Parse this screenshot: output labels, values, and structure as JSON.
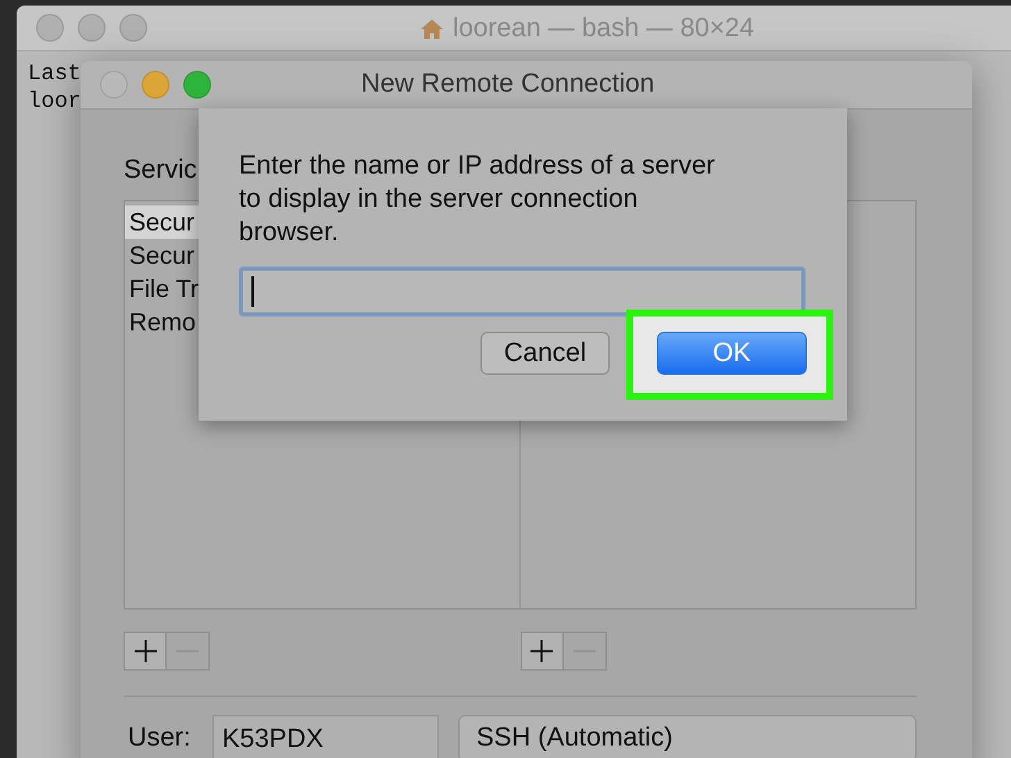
{
  "terminal": {
    "title": "loorean — bash — 80×24",
    "lines": [
      "Last",
      "loor"
    ]
  },
  "dialog": {
    "title": "New Remote Connection",
    "services_label": "Servic",
    "services": [
      {
        "label": "Secur",
        "selected": true
      },
      {
        "label": "Secur",
        "selected": false
      },
      {
        "label": "File Tr",
        "selected": false
      },
      {
        "label": "Remo",
        "selected": false
      }
    ],
    "user_label": "User:",
    "user_value": "K53PDX",
    "protocol": "SSH (Automatic)"
  },
  "sheet": {
    "prompt": "Enter the name or IP address of a server to display in the server connection browser.",
    "focused": true,
    "buttons": [
      {
        "label": "Cancel",
        "kind": "normal",
        "highlighted": false
      },
      {
        "label": "OK",
        "kind": "default",
        "highlighted": true
      }
    ]
  }
}
